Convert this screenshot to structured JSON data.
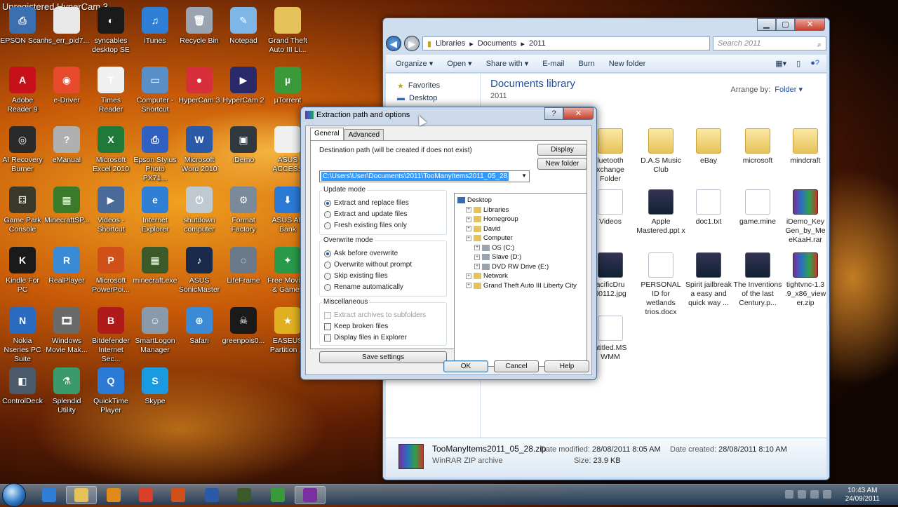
{
  "watermark": "Unregistered HyperCam 3",
  "desktop_icons": [
    {
      "label": "EPSON Scan",
      "color": "#3a6fb0",
      "glyph": "⎙"
    },
    {
      "label": "hs_err_pid7...",
      "color": "#e8e8e8",
      "glyph": ""
    },
    {
      "label": "syncables desktop SE",
      "color": "#1a1a1a",
      "glyph": "◐"
    },
    {
      "label": "iTunes",
      "color": "#2f7fd6",
      "glyph": "♫"
    },
    {
      "label": "Recycle Bin",
      "color": "#9aa4b0",
      "glyph": "🗑"
    },
    {
      "label": "Notepad",
      "color": "#7fb6e8",
      "glyph": "✎"
    },
    {
      "label": "Grand Theft Auto III Li...",
      "color": "#e6c35a",
      "glyph": ""
    },
    {
      "label": "Adobe Reader 9",
      "color": "#c8101a",
      "glyph": "A"
    },
    {
      "label": "e-Driver",
      "color": "#e64a2a",
      "glyph": "◉"
    },
    {
      "label": "Times Reader",
      "color": "#f0f0f0",
      "glyph": "T"
    },
    {
      "label": "Computer - Shortcut",
      "color": "#5a8fc8",
      "glyph": "▭"
    },
    {
      "label": "HyperCam 3",
      "color": "#d8303a",
      "glyph": "●"
    },
    {
      "label": "HyperCam 2",
      "color": "#2a2a6a",
      "glyph": "▶"
    },
    {
      "label": "µTorrent",
      "color": "#3a9a3a",
      "glyph": "µ"
    },
    {
      "label": "AI Recovery Burner",
      "color": "#2a2a2a",
      "glyph": "◎"
    },
    {
      "label": "eManual",
      "color": "#b0b0b0",
      "glyph": "?"
    },
    {
      "label": "Microsoft Excel 2010",
      "color": "#1f7a3a",
      "glyph": "X"
    },
    {
      "label": "Epson Stylus Photo PX71...",
      "color": "#3060c0",
      "glyph": "⎙"
    },
    {
      "label": "Microsoft Word 2010",
      "color": "#2a5aa8",
      "glyph": "W"
    },
    {
      "label": "iDemo",
      "color": "#303840",
      "glyph": "▣"
    },
    {
      "label": "ASUS ACCESS",
      "color": "#f0f0f0",
      "glyph": ""
    },
    {
      "label": "Game Park Console",
      "color": "#3a3a2a",
      "glyph": "⚃"
    },
    {
      "label": "MinecraftSP...",
      "color": "#3a7a2a",
      "glyph": "▦"
    },
    {
      "label": "Videos - Shortcut",
      "color": "#4a6a9a",
      "glyph": "▶"
    },
    {
      "label": "Internet Explorer",
      "color": "#2f7fd6",
      "glyph": "e"
    },
    {
      "label": "shutdown computer",
      "color": "#c0c8d0",
      "glyph": "⏻"
    },
    {
      "label": "Format Factory",
      "color": "#7a8a9a",
      "glyph": "⚙"
    },
    {
      "label": "ASUS AP Bank",
      "color": "#2a7ad6",
      "glyph": "⬇"
    },
    {
      "label": "Kindle For PC",
      "color": "#1a1a1a",
      "glyph": "K"
    },
    {
      "label": "RealPlayer",
      "color": "#3a8ad6",
      "glyph": "R"
    },
    {
      "label": "Microsoft PowerPoi...",
      "color": "#d0501a",
      "glyph": "P"
    },
    {
      "label": "minecraft.exe",
      "color": "#3a5a2a",
      "glyph": "▦"
    },
    {
      "label": "ASUS SonicMaster",
      "color": "#1a2a4a",
      "glyph": "♪"
    },
    {
      "label": "LifeFrame",
      "color": "#6a7a8a",
      "glyph": "◌"
    },
    {
      "label": "Free Movies & Games",
      "color": "#2a9a4a",
      "glyph": "✦"
    },
    {
      "label": "Nokia Nseries PC Suite",
      "color": "#2a6ac0",
      "glyph": "N"
    },
    {
      "label": "Windows Movie Mak...",
      "color": "#6a6a6a",
      "glyph": "🎞"
    },
    {
      "label": "Bitdefender Internet Sec...",
      "color": "#b01a1a",
      "glyph": "B"
    },
    {
      "label": "SmartLogon Manager",
      "color": "#8a9aaa",
      "glyph": "☺"
    },
    {
      "label": "Safari",
      "color": "#3a8ad6",
      "glyph": "⊕"
    },
    {
      "label": "greenpois0...",
      "color": "#1a1a1a",
      "glyph": "☠"
    },
    {
      "label": "EASEUS Partition ...",
      "color": "#e0b020",
      "glyph": "★"
    },
    {
      "label": "ControlDeck",
      "color": "#4a5a6a",
      "glyph": "◧"
    },
    {
      "label": "Splendid Utility",
      "color": "#3a9a6a",
      "glyph": "⚗"
    },
    {
      "label": "QuickTime Player",
      "color": "#2a7ad6",
      "glyph": "Q"
    },
    {
      "label": "Skype",
      "color": "#1a9ae0",
      "glyph": "S"
    }
  ],
  "explorer": {
    "breadcrumb": [
      "Libraries",
      "Documents",
      "2011"
    ],
    "search_placeholder": "Search 2011",
    "toolbar": [
      "Organize ▾",
      "Open ▾",
      "Share with ▾",
      "E-mail",
      "Burn",
      "New folder"
    ],
    "nav": [
      "Favorites",
      "Desktop"
    ],
    "library_title": "Documents library",
    "library_sub": "2011",
    "arrange_label": "Arrange by:",
    "arrange_value": "Folder ▾",
    "files": [
      {
        "name": "luetooth xchange Folder",
        "type": "folder"
      },
      {
        "name": "D.A.S Music Club",
        "type": "folder"
      },
      {
        "name": "eBay",
        "type": "folder"
      },
      {
        "name": "microsoft",
        "type": "folder"
      },
      {
        "name": "mindcraft",
        "type": "folder"
      },
      {
        "name": "Videos",
        "type": "doc"
      },
      {
        "name": "Apple Mastered.ppt x",
        "type": "img"
      },
      {
        "name": "doc1.txt",
        "type": "doc"
      },
      {
        "name": "game.mine",
        "type": "doc"
      },
      {
        "name": "iDemo_Key Gen_by_Me eKaaH.rar",
        "type": "rar"
      },
      {
        "name": "acificDru 00112.jpg",
        "type": "img"
      },
      {
        "name": "PERSONAL ID for wetlands trios.docx",
        "type": "doc"
      },
      {
        "name": "Spirit jailbreak a easy and quick way ...",
        "type": "img"
      },
      {
        "name": "The Inventions of the last Century.p...",
        "type": "img"
      },
      {
        "name": "tightvnc-1.3 .9_x86_view er.zip",
        "type": "rar"
      },
      {
        "name": "ntitled.MS WMM",
        "type": "doc"
      }
    ],
    "details": {
      "name": "TooManyItems2011_05_28.zip",
      "type": "WinRAR ZIP archive",
      "modified_label": "Date modified:",
      "modified": "28/08/2011 8:05 AM",
      "created_label": "Date created:",
      "created": "28/08/2011 8:10 AM",
      "size_label": "Size:",
      "size": "23.9 KB"
    }
  },
  "dialog": {
    "title": "Extraction path and options",
    "tabs": [
      "General",
      "Advanced"
    ],
    "dest_label": "Destination path (will be created if does not exist)",
    "dest_value": "C:\\Users\\User\\Documents\\2011\\TooManyItems2011_05_28",
    "display_btn": "Display",
    "new_folder_btn": "New folder",
    "update_mode_label": "Update mode",
    "update_options": [
      "Extract and replace files",
      "Extract and update files",
      "Fresh existing files only"
    ],
    "overwrite_mode_label": "Overwrite mode",
    "overwrite_options": [
      "Ask before overwrite",
      "Overwrite without prompt",
      "Skip existing files",
      "Rename automatically"
    ],
    "misc_label": "Miscellaneous",
    "misc_options": [
      "Extract archives to subfolders",
      "Keep broken files",
      "Display files in Explorer"
    ],
    "save_btn": "Save settings",
    "tree": [
      {
        "label": "Desktop",
        "level": 0
      },
      {
        "label": "Libraries",
        "level": 1
      },
      {
        "label": "Homegroup",
        "level": 1
      },
      {
        "label": "David",
        "level": 1
      },
      {
        "label": "Computer",
        "level": 1
      },
      {
        "label": "OS (C:)",
        "level": 2
      },
      {
        "label": "Slave (D:)",
        "level": 2
      },
      {
        "label": "DVD RW Drive (E:)",
        "level": 2
      },
      {
        "label": "Network",
        "level": 1
      },
      {
        "label": "Grand Theft Auto III Liberty City",
        "level": 1
      }
    ],
    "ok_btn": "OK",
    "cancel_btn": "Cancel",
    "help_btn": "Help"
  },
  "taskbar": {
    "apps": [
      {
        "name": "internet-explorer",
        "color": "#2f7fd6"
      },
      {
        "name": "windows-explorer",
        "color": "#e6c35a"
      },
      {
        "name": "media-player",
        "color": "#e08a1a"
      },
      {
        "name": "chrome",
        "color": "#d8402a"
      },
      {
        "name": "powerpoint",
        "color": "#d0501a"
      },
      {
        "name": "word",
        "color": "#2a5aa8"
      },
      {
        "name": "minecraft",
        "color": "#3a5a2a"
      },
      {
        "name": "utorrent",
        "color": "#3a9a3a"
      },
      {
        "name": "winrar",
        "color": "#7a2ea0"
      }
    ],
    "time": "10:43 AM",
    "date": "24/09/2011"
  }
}
